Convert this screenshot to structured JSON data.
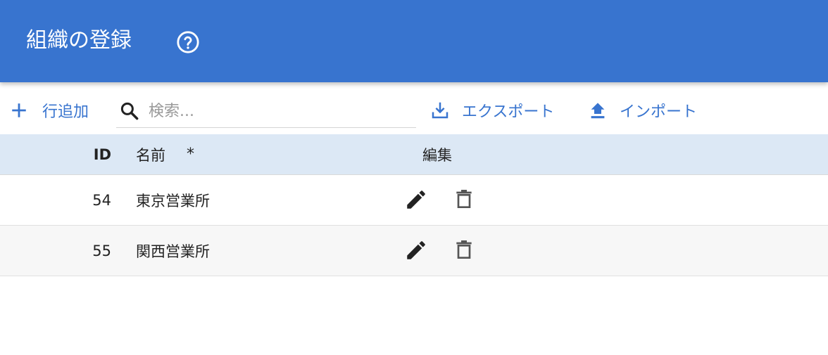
{
  "header": {
    "title": "組織の登録",
    "help_icon": "help-circle-icon",
    "background": "#3874cf"
  },
  "toolbar": {
    "add_row_label": "行追加",
    "search": {
      "placeholder": "検索...",
      "value": ""
    },
    "export_label": "エクスポート",
    "import_label": "インポート",
    "accent": "#3874cf"
  },
  "table": {
    "columns": {
      "id": "ID",
      "name": "名前",
      "required_mark": "*",
      "edit": "編集"
    },
    "rows": [
      {
        "id": "54",
        "name": "東京営業所"
      },
      {
        "id": "55",
        "name": "関西営業所"
      }
    ]
  }
}
